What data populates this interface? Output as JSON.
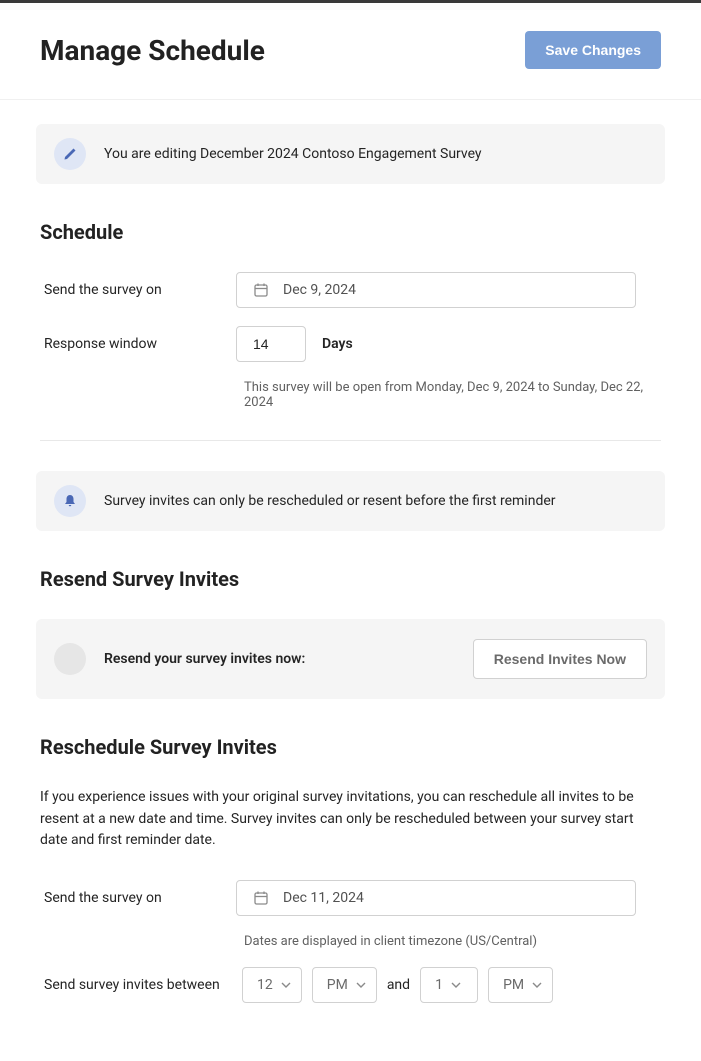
{
  "header": {
    "title": "Manage Schedule",
    "save": "Save Changes"
  },
  "editBanner": {
    "text": "You are editing December 2024 Contoso Engagement Survey"
  },
  "schedule": {
    "title": "Schedule",
    "sendLabel": "Send the survey on",
    "sendDate": "Dec 9, 2024",
    "responseLabel": "Response window",
    "responseValue": "14",
    "daysLabel": "Days",
    "openText": "This survey will be open from Monday, Dec 9, 2024 to Sunday, Dec 22, 2024"
  },
  "reminderBanner": {
    "text": "Survey invites can only be rescheduled or resent before the first reminder"
  },
  "resend": {
    "title": "Resend Survey Invites",
    "prompt": "Resend your survey invites now:",
    "button": "Resend Invites Now"
  },
  "reschedule": {
    "title": "Reschedule Survey Invites",
    "description": "If you experience issues with your original survey invitations, you can reschedule all invites to be resent at a new date and time. Survey invites can only be rescheduled between your survey start date and first reminder date.",
    "sendLabel": "Send the survey on",
    "sendDate": "Dec 11, 2024",
    "tzNote": "Dates are displayed in client timezone (US/Central)",
    "betweenLabel": "Send survey invites between",
    "hourFrom": "12",
    "ampmFrom": "PM",
    "andText": "and",
    "hourTo": "1",
    "ampmTo": "PM"
  }
}
